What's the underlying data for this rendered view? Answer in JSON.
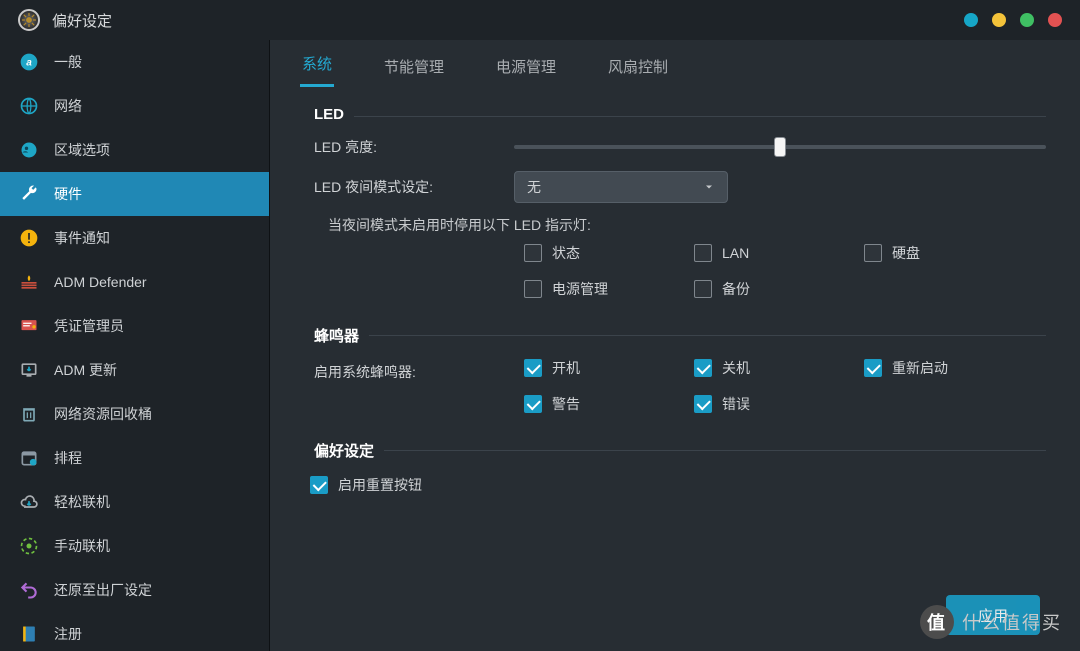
{
  "window": {
    "title": "偏好设定"
  },
  "windowButtons": [
    "blue",
    "yellow",
    "green",
    "red"
  ],
  "sidebar": {
    "items": [
      {
        "id": "general",
        "label": "一般",
        "icon": "grid-icon"
      },
      {
        "id": "network",
        "label": "网络",
        "icon": "globe-icon"
      },
      {
        "id": "region",
        "label": "区域选项",
        "icon": "region-icon"
      },
      {
        "id": "hardware",
        "label": "硬件",
        "icon": "wrench-icon",
        "active": true
      },
      {
        "id": "notify",
        "label": "事件通知",
        "icon": "alert-icon"
      },
      {
        "id": "defender",
        "label": "ADM Defender",
        "icon": "firewall-icon"
      },
      {
        "id": "cert",
        "label": "凭证管理员",
        "icon": "cert-icon"
      },
      {
        "id": "update",
        "label": "ADM 更新",
        "icon": "update-icon"
      },
      {
        "id": "trash",
        "label": "网络资源回收桶",
        "icon": "trash-icon"
      },
      {
        "id": "schedule",
        "label": "排程",
        "icon": "calendar-icon"
      },
      {
        "id": "ezconnect",
        "label": "轻松联机",
        "icon": "cloud-icon"
      },
      {
        "id": "manual",
        "label": "手动联机",
        "icon": "dial-icon"
      },
      {
        "id": "factory",
        "label": "还原至出厂设定",
        "icon": "undo-icon"
      },
      {
        "id": "register",
        "label": "注册",
        "icon": "register-icon"
      }
    ]
  },
  "tabs": [
    {
      "id": "system",
      "label": "系统",
      "active": true
    },
    {
      "id": "power-save",
      "label": "节能管理"
    },
    {
      "id": "power-mgmt",
      "label": "电源管理"
    },
    {
      "id": "fan",
      "label": "风扇控制"
    }
  ],
  "sections": {
    "led": {
      "legend": "LED",
      "brightnessLabel": "LED 亮度:",
      "brightnessValue": 50,
      "nightModeLabel": "LED 夜间模式设定:",
      "nightModeSelected": "无",
      "nightNote": "当夜间模式未启用时停用以下 LED 指示灯:",
      "indicators": [
        {
          "id": "status",
          "label": "状态",
          "checked": false
        },
        {
          "id": "lan",
          "label": "LAN",
          "checked": false
        },
        {
          "id": "hdd",
          "label": "硬盘",
          "checked": false
        },
        {
          "id": "pwrmgmt",
          "label": "电源管理",
          "checked": false
        },
        {
          "id": "backup",
          "label": "备份",
          "checked": false
        }
      ]
    },
    "buzzer": {
      "legend": "蜂鸣器",
      "enableLabel": "启用系统蜂鸣器:",
      "events": [
        {
          "id": "boot",
          "label": "开机",
          "checked": true
        },
        {
          "id": "shutdown",
          "label": "关机",
          "checked": true
        },
        {
          "id": "reboot",
          "label": "重新启动",
          "checked": true
        },
        {
          "id": "warning",
          "label": "警告",
          "checked": true
        },
        {
          "id": "error",
          "label": "错误",
          "checked": true
        }
      ]
    },
    "pref": {
      "legend": "偏好设定",
      "resetBtn": {
        "label": "启用重置按钮",
        "checked": true
      }
    }
  },
  "applyLabel": "应用",
  "watermark": "什么值得买"
}
